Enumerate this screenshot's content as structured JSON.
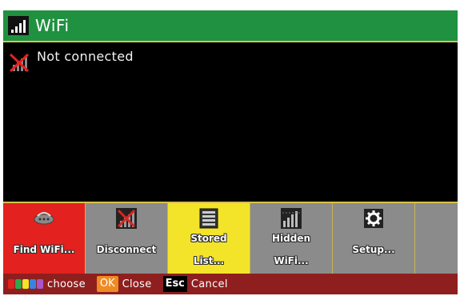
{
  "titlebar": {
    "title": "WiFi",
    "icon": "signal-bars-icon"
  },
  "status": {
    "label": "Not connected",
    "icon": "disconnected-icon"
  },
  "buttons": [
    {
      "label": "Find WiFi...",
      "icon": "router-icon",
      "color": "#e3211e"
    },
    {
      "label": "Disconnect",
      "icon": "disconnect-icon",
      "color": "#8b8b8b"
    },
    {
      "label_line1": "Stored",
      "label_line2": "List...",
      "icon": "list-icon",
      "color": "#f3e42a"
    },
    {
      "label_line1": "Hidden",
      "label_line2": "WiFi...",
      "icon": "hidden-wifi-icon",
      "color": "#8b8b8b"
    },
    {
      "label": "Setup...",
      "icon": "gear-icon",
      "color": "#8b8b8b"
    }
  ],
  "footer": {
    "color_keys": [
      "#e3211e",
      "#2ea84a",
      "#f3e42a",
      "#3b82e0",
      "#a855c8"
    ],
    "choose_label": "choose",
    "ok_key": "OK",
    "close_label": "Close",
    "esc_key": "Esc",
    "cancel_label": "Cancel"
  },
  "colors": {
    "title_bg": "#1f9140",
    "footer_bg": "#8e1f1e",
    "border": "#d8c24a"
  }
}
